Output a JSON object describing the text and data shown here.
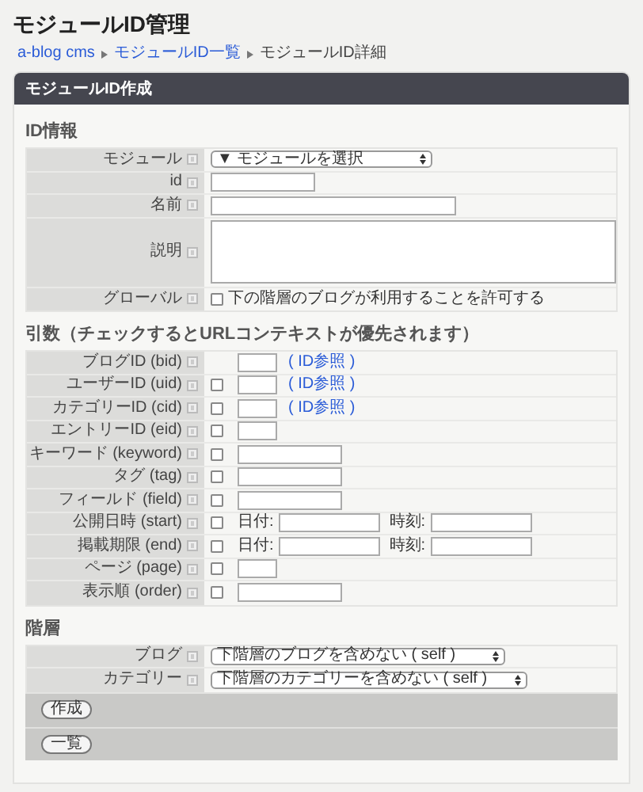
{
  "page_title": "モジュールID管理",
  "breadcrumb": [
    {
      "label": "a-blog cms",
      "link": true
    },
    {
      "label": "モジュールID一覧",
      "link": true
    },
    {
      "label": "モジュールID詳細",
      "link": false
    }
  ],
  "panel_title": "モジュールID作成",
  "sections": [
    {
      "heading": "ID情報",
      "option_column": false,
      "rows": [
        {
          "label": "モジュール",
          "kind": "select",
          "value": "▼ モジュールを選択"
        },
        {
          "label": "id",
          "kind": "text-medium"
        },
        {
          "label": "名前",
          "kind": "text-long"
        },
        {
          "label": "説明",
          "kind": "textarea"
        },
        {
          "label": "グローバル",
          "kind": "checkbox",
          "checked": false,
          "text": "下の階層のブログが利用することを許可する"
        }
      ]
    },
    {
      "heading": "引数（チェックするとURLコンテキストが優先されます）",
      "option_column": true,
      "rows": [
        {
          "label": "ブログID (bid)",
          "kind": "text-short",
          "link": "( ID参照 )"
        },
        {
          "label": "ユーザーID (uid)",
          "kind": "text-short",
          "checked": false,
          "link": "( ID参照 )"
        },
        {
          "label": "カテゴリーID (cid)",
          "kind": "text-short",
          "checked": false,
          "link": "( ID参照 )"
        },
        {
          "label": "エントリーID (eid)",
          "kind": "text-short",
          "checked": false
        },
        {
          "label": "キーワード (keyword)",
          "kind": "text-medium",
          "checked": false
        },
        {
          "label": "タグ (tag)",
          "kind": "text-medium",
          "checked": false
        },
        {
          "label": "フィールド (field)",
          "kind": "text-medium",
          "checked": false
        },
        {
          "label": "公開日時 (start)",
          "kind": "datetime",
          "checked": false,
          "date_label": "日付:",
          "time_label": "時刻:"
        },
        {
          "label": "掲載期限 (end)",
          "kind": "datetime",
          "checked": false,
          "date_label": "日付:",
          "time_label": "時刻:"
        },
        {
          "label": "ページ (page)",
          "kind": "text-short",
          "checked": false
        },
        {
          "label": "表示順 (order)",
          "kind": "text-medium",
          "checked": false
        }
      ]
    },
    {
      "heading": "階層",
      "option_column": false,
      "rows": [
        {
          "label": "ブログ",
          "kind": "select",
          "value": "下階層のブログを含めない ( self )"
        },
        {
          "label": "カテゴリー",
          "kind": "select",
          "value": "下階層のカテゴリーを含めない ( self )"
        }
      ]
    }
  ],
  "buttons": [
    {
      "label": "作成"
    },
    {
      "label": "一覧"
    }
  ]
}
